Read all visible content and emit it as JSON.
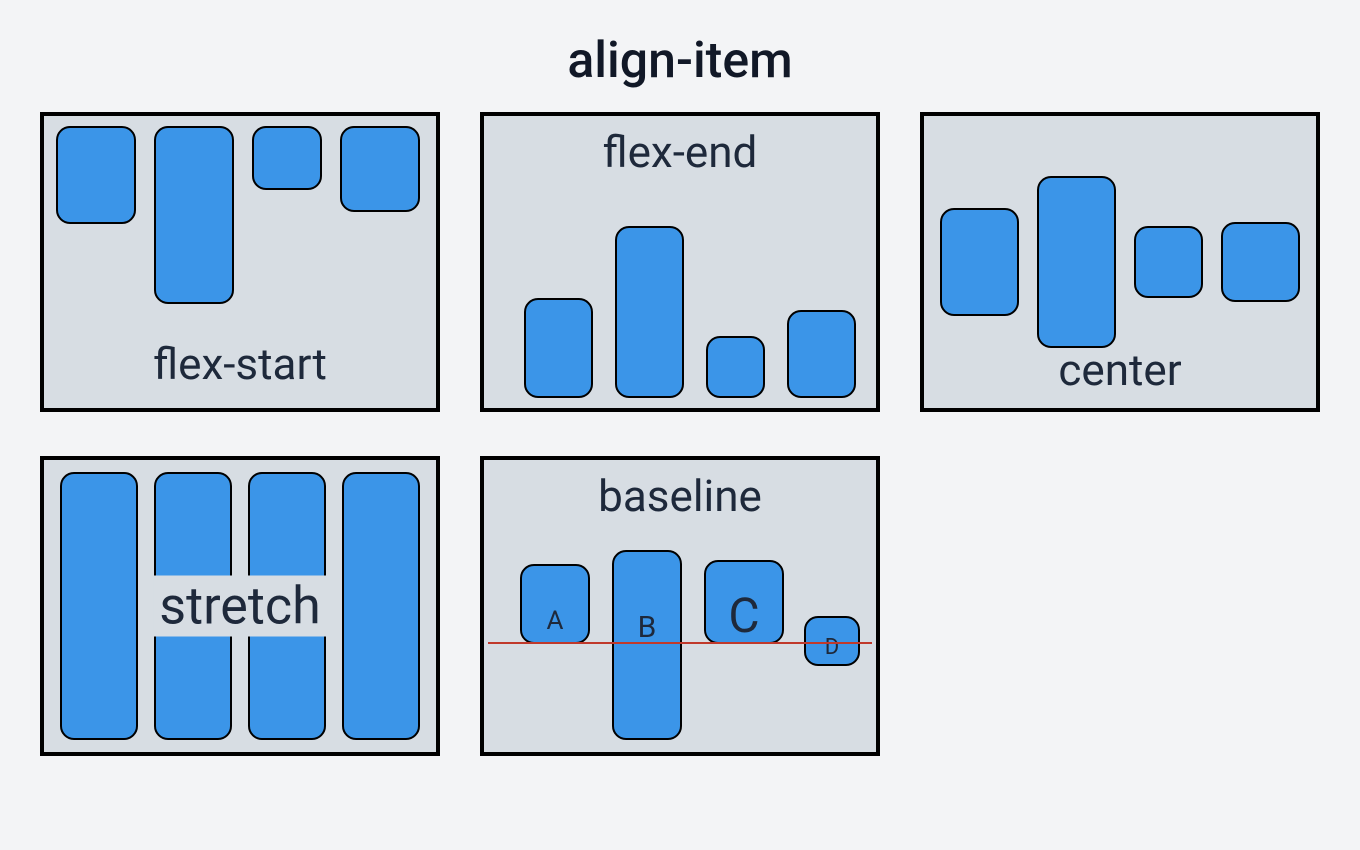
{
  "title": "align-item",
  "panels": {
    "flex_start": {
      "label": "flex-start"
    },
    "flex_end": {
      "label": "flex-end"
    },
    "center": {
      "label": "center"
    },
    "stretch": {
      "label": "stretch"
    },
    "baseline": {
      "label": "baseline",
      "items": [
        "A",
        "B",
        "C",
        "D"
      ]
    }
  },
  "colors": {
    "page_bg": "#f3f4f6",
    "panel_bg": "#d7dde3",
    "item_fill": "#3b95e8",
    "border": "#000000",
    "baseline_rule": "#c0392b",
    "text": "#1e293b"
  }
}
